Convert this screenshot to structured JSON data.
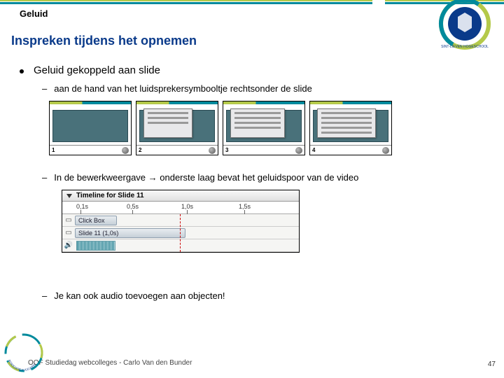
{
  "header": {
    "tag": "Geluid"
  },
  "title": "Inspreken tijdens het opnemen",
  "bullets": {
    "main": "Geluid gekoppeld aan slide",
    "sub1": "aan de hand van het luidsprekersymbooltje rechtsonder de slide",
    "sub2": "In de bewerkweergave → onderste laag bevat het geluidspoor van de video",
    "sub3": "Je kan ook audio toevoegen aan objecten!"
  },
  "thumbs": {
    "labels": [
      "1",
      "2",
      "3",
      "4"
    ]
  },
  "timeline": {
    "title": "Timeline for Slide 11",
    "ticks": [
      "0,1s",
      "0,5s",
      "1,0s",
      "1,5s"
    ],
    "row1": "Click Box",
    "row2": "Slide 11 (1,0s)"
  },
  "footer": "OOF Studiedag webcolleges - Carlo Van den Bunder",
  "page": "47",
  "logo_top_text": "SINT-LIEVEN HOGESCHOOL",
  "logo_bot_text": "ASSOCIATIE KULEUVEN"
}
